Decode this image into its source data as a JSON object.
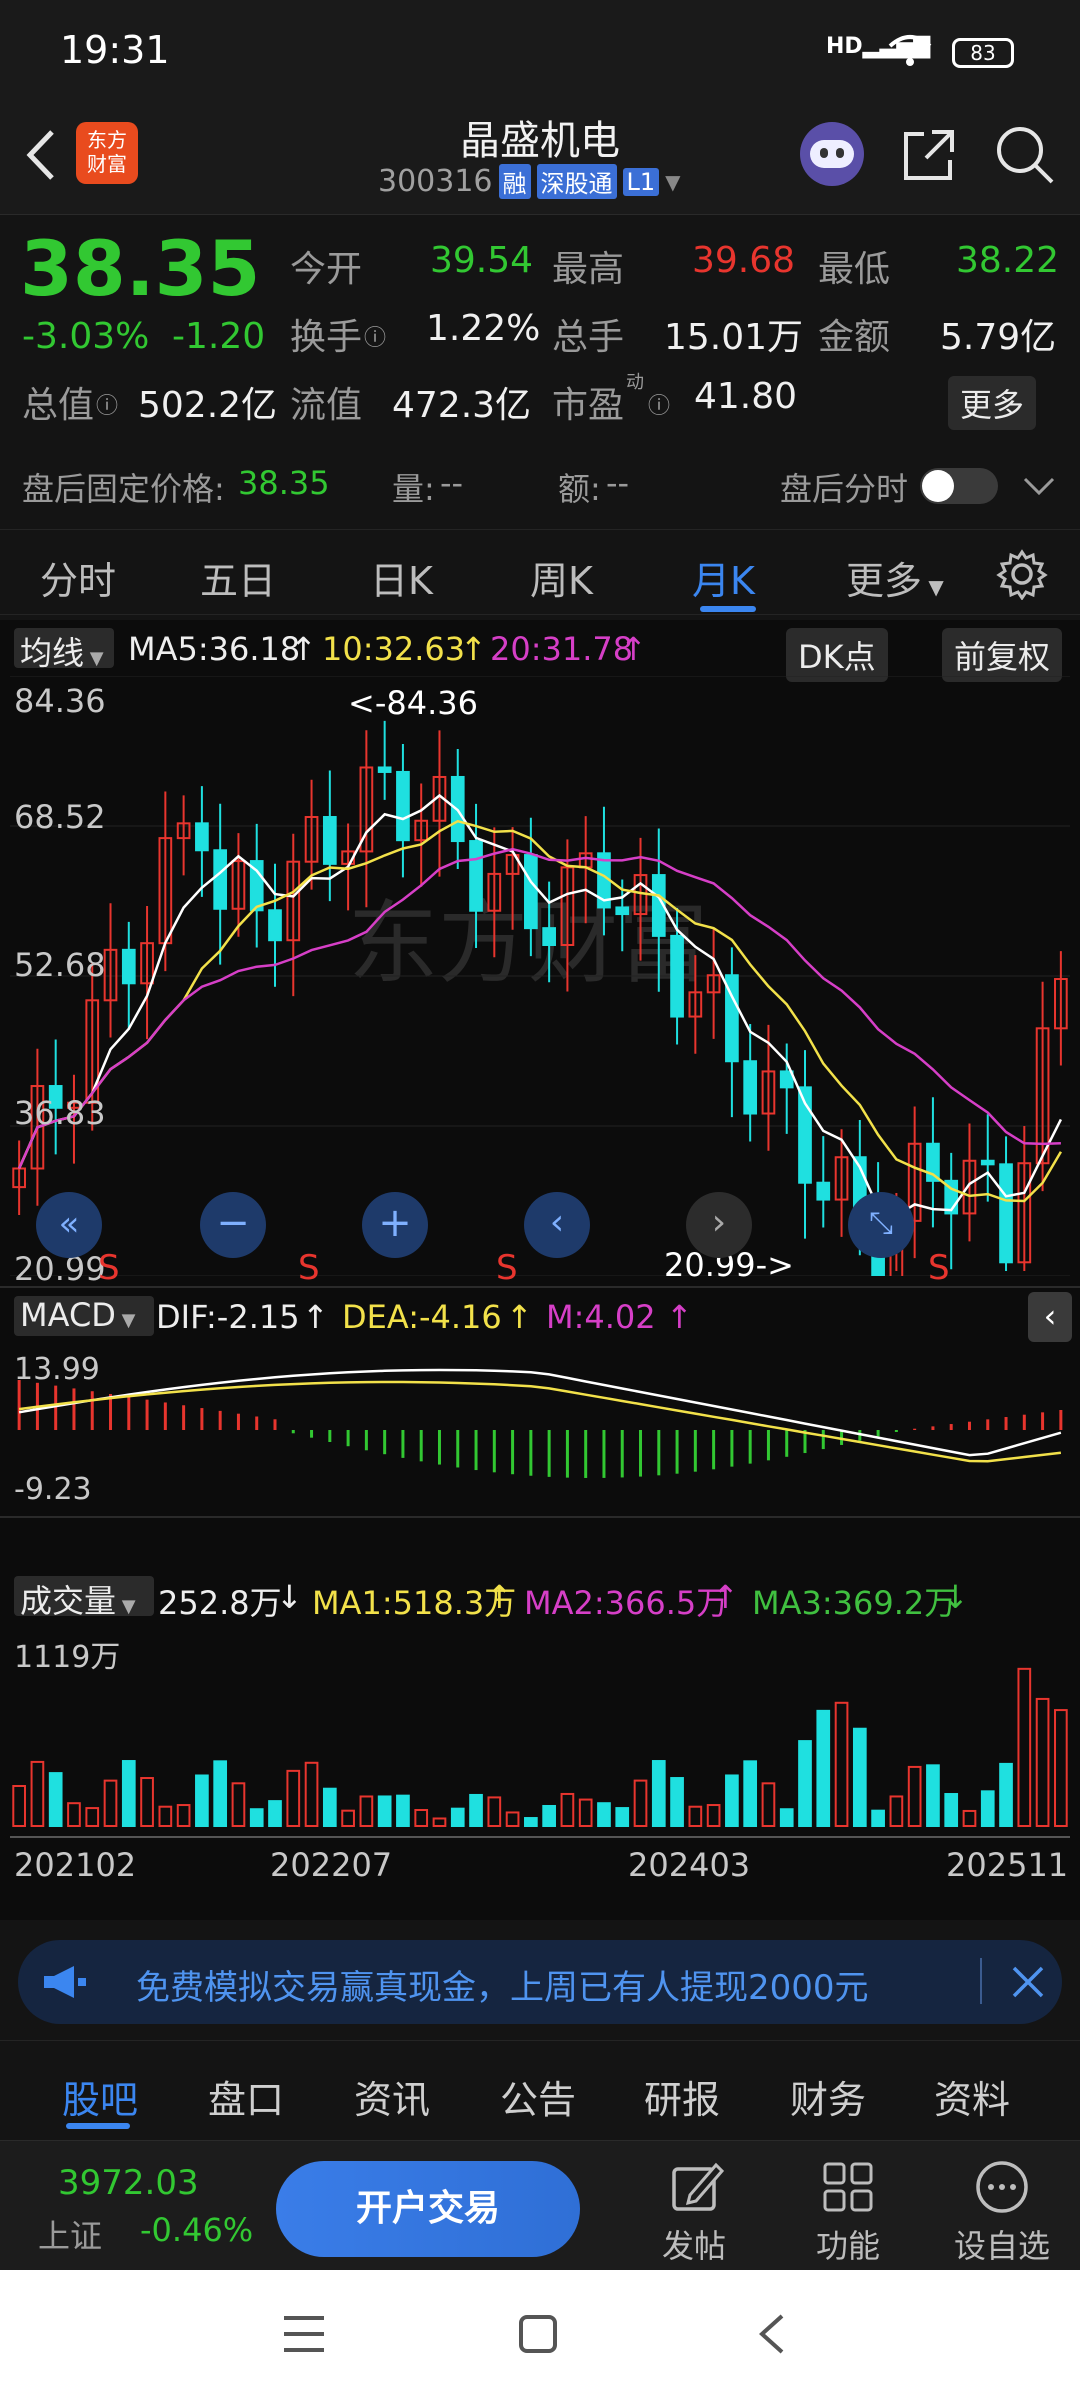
{
  "status": {
    "time": "19:31",
    "battery": "83"
  },
  "header": {
    "logo_text": "东方\n财富",
    "stock_name": "晶盛机电",
    "code": "300316",
    "badge1": "融",
    "badge2": "深股通",
    "badge3": "L1"
  },
  "quote": {
    "price": "38.35",
    "pct": "-3.03%",
    "change": "-1.20",
    "open_label": "今开",
    "open": "39.54",
    "high_label": "最高",
    "high": "39.68",
    "low_label": "最低",
    "low": "38.22",
    "turnover_label": "换手",
    "turnover": "1.22%",
    "volume_label": "总手",
    "volume": "15.01万",
    "amount_label": "金额",
    "amount": "5.79亿",
    "mcap_label": "总值",
    "mcap": "502.2亿",
    "float_label": "流值",
    "float": "472.3亿",
    "pe_label": "市盈",
    "pe_sup": "动",
    "pe": "41.80",
    "more_label": "更多"
  },
  "afterhours": {
    "fixed_label": "盘后固定价格:",
    "fixed_price": "38.35",
    "vol_label": "量:",
    "vol": "--",
    "amt_label": "额:",
    "amt": "--",
    "toggle_label": "盘后分时"
  },
  "tabs": [
    "分时",
    "五日",
    "日K",
    "周K",
    "月K",
    "更多"
  ],
  "chart": {
    "ma_selector": "均线",
    "ma5": "MA5:36.18",
    "ma10": "10:32.63",
    "ma20": "20:31.78",
    "dk_label": "DK点",
    "fq_label": "前复权",
    "y_top": "84.36",
    "y_2": "68.52",
    "y_3": "52.68",
    "y_4": "36.83",
    "y_bottom": "20.99",
    "max_note": "<-84.36",
    "min_note": "20.99->",
    "watermark": "东方财富",
    "macd_selector": "MACD",
    "dif": "DIF:-2.15",
    "dea": "DEA:-4.16",
    "m": "M:4.02",
    "macd_top": "13.99",
    "macd_bottom": "-9.23",
    "vol_selector": "成交量",
    "vol_value": "252.8万",
    "vma1": "MA1:518.3万",
    "vma2": "MA2:366.5万",
    "vma3": "MA3:369.2万",
    "vol_top": "1119万",
    "dates": [
      "202102",
      "202207",
      "202403",
      "202511"
    ],
    "s_mark": "S"
  },
  "banner": {
    "text": "免费模拟交易赢真现金，上周已有人提现2000元"
  },
  "bottom_tabs": [
    "股吧",
    "盘口",
    "资讯",
    "公告",
    "研报",
    "财务",
    "资料"
  ],
  "footer": {
    "index_value": "3972.03",
    "index_name": "上证",
    "index_pct": "-0.46%",
    "trade_button": "开户交易",
    "post_label": "发帖",
    "func_label": "功能",
    "watch_label": "设自选"
  }
}
